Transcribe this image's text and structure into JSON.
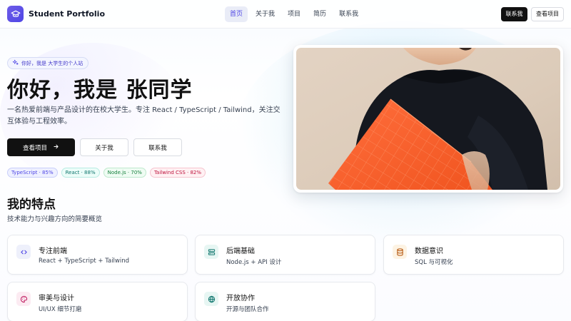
{
  "brand": {
    "name": "Student Portfolio",
    "logo_icon": "graduation-cap-icon",
    "color": "#5b50e6"
  },
  "nav": {
    "items": [
      {
        "label": "首页",
        "active": true
      },
      {
        "label": "关于我",
        "active": false
      },
      {
        "label": "项目",
        "active": false
      },
      {
        "label": "简历",
        "active": false
      },
      {
        "label": "联系我",
        "active": false
      }
    ]
  },
  "header_buttons": {
    "contact": "联系我",
    "projects": "查看项目"
  },
  "hero": {
    "badge": "你好，我是 大学生的个人站",
    "badge_icon": "sparkles-icon",
    "title": "你好，我是 张同学",
    "description": "一名热爱前端与产品设计的在校大学生。专注 React / TypeScript / Tailwind，关注交互体验与工程效率。",
    "primary_button": "查看项目",
    "about_button": "关于我",
    "contact_button": "联系我",
    "skills": [
      {
        "label": "TypeScript · 85%",
        "color": "#4f46e5",
        "bg": "#eef0ff",
        "border": "#c9cffa"
      },
      {
        "label": "React · 88%",
        "color": "#0f766e",
        "bg": "#ecfdf9",
        "border": "#b9ece3"
      },
      {
        "label": "Node.js · 70%",
        "color": "#15803d",
        "bg": "#effcf3",
        "border": "#bfe9cd"
      },
      {
        "label": "Tailwind CSS · 82%",
        "color": "#be123c",
        "bg": "#fff1f3",
        "border": "#f6c4cf"
      }
    ]
  },
  "features": {
    "title": "我的特点",
    "subtitle": "技术能力与兴趣方向的简要概览",
    "items": [
      {
        "title": "专注前端",
        "desc": "React + TypeScript + Tailwind",
        "icon": "code-icon",
        "color": "#4f46e5",
        "bg": "#eef0fb"
      },
      {
        "title": "后端基础",
        "desc": "Node.js + API 设计",
        "icon": "server-icon",
        "color": "#0f766e",
        "bg": "#e7f6f3"
      },
      {
        "title": "数据意识",
        "desc": "SQL 与可视化",
        "icon": "database-icon",
        "color": "#b45309",
        "bg": "#fdf3e3"
      },
      {
        "title": "审美与设计",
        "desc": "UI/UX 细节打磨",
        "icon": "palette-icon",
        "color": "#be185d",
        "bg": "#fcebf2"
      },
      {
        "title": "开放协作",
        "desc": "开源与团队合作",
        "icon": "globe-icon",
        "color": "#0f766e",
        "bg": "#e7f6f3"
      }
    ]
  }
}
